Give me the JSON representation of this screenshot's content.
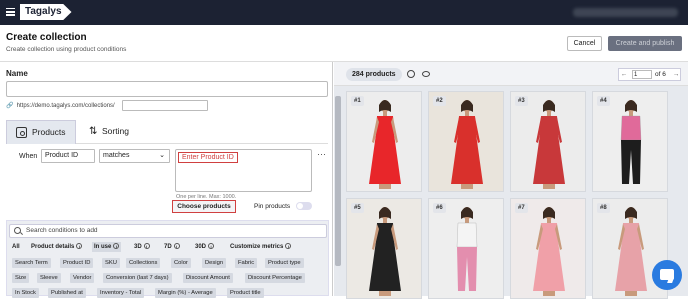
{
  "topbar": {
    "logo": "Tagalys"
  },
  "header": {
    "title": "Create collection",
    "subtitle": "Create collection using product conditions",
    "cancel_label": "Cancel",
    "create_label": "Create and publish"
  },
  "form": {
    "name_label": "Name",
    "name_value": "",
    "url_prefix": "https://demo.tagalys.com/collections/",
    "url_value": ""
  },
  "tabs": [
    {
      "label": "Products",
      "active": true
    },
    {
      "label": "Sorting",
      "active": false
    }
  ],
  "condition": {
    "when_label": "When",
    "field": "Product ID",
    "operator": "matches",
    "placeholder": "Enter Product ID",
    "help_text": "One per line. Max: 1000.",
    "choose_label": "Choose products",
    "pin_label": "Pin products",
    "pin_enabled": false
  },
  "conditions_panel": {
    "search_placeholder": "Search conditions to add",
    "categories": [
      {
        "label": "All",
        "info": false,
        "active": false
      },
      {
        "label": "Product details",
        "info": true,
        "active": false
      },
      {
        "label": "In use",
        "info": true,
        "active": true
      },
      {
        "label": "3D",
        "info": true,
        "active": false
      },
      {
        "label": "7D",
        "info": true,
        "active": false
      },
      {
        "label": "30D",
        "info": true,
        "active": false
      },
      {
        "label": "Customize metrics",
        "info": true,
        "active": false
      }
    ],
    "chips_row1": [
      "Search Term",
      "Product ID",
      "SKU",
      "Collections",
      "Color",
      "Design",
      "Fabric",
      "Product type"
    ],
    "chips_row2": [
      "Size",
      "Sleeve",
      "Vendor",
      "Conversion (last 7 days)",
      "Discount Amount",
      "Discount Percentage"
    ],
    "chips_row3": [
      "In Stock",
      "Published at",
      "Inventory - Total",
      "Margin (%) - Average",
      "Product title"
    ]
  },
  "preview": {
    "count": "284 products",
    "page": "1",
    "of_label": "of 6",
    "products": [
      {
        "num": "#1",
        "dress_color": "#e8262a",
        "bg": "#ededed"
      },
      {
        "num": "#2",
        "dress_color": "#d9302c",
        "bg": "#e9e4dc"
      },
      {
        "num": "#3",
        "dress_color": "#c8383a",
        "bg": "#ececec"
      },
      {
        "num": "#4",
        "dress_color": "#1d1d1d",
        "bg": "#eeeeee"
      },
      {
        "num": "#5",
        "dress_color": "#222222",
        "bg": "#ece9e4"
      },
      {
        "num": "#6",
        "dress_color": "#e38eae",
        "bg": "#eeeeee"
      },
      {
        "num": "#7",
        "dress_color": "#f0a0a8",
        "bg": "#efeaea"
      },
      {
        "num": "#8",
        "dress_color": "#e7a2a8",
        "bg": "#ececec"
      }
    ]
  }
}
